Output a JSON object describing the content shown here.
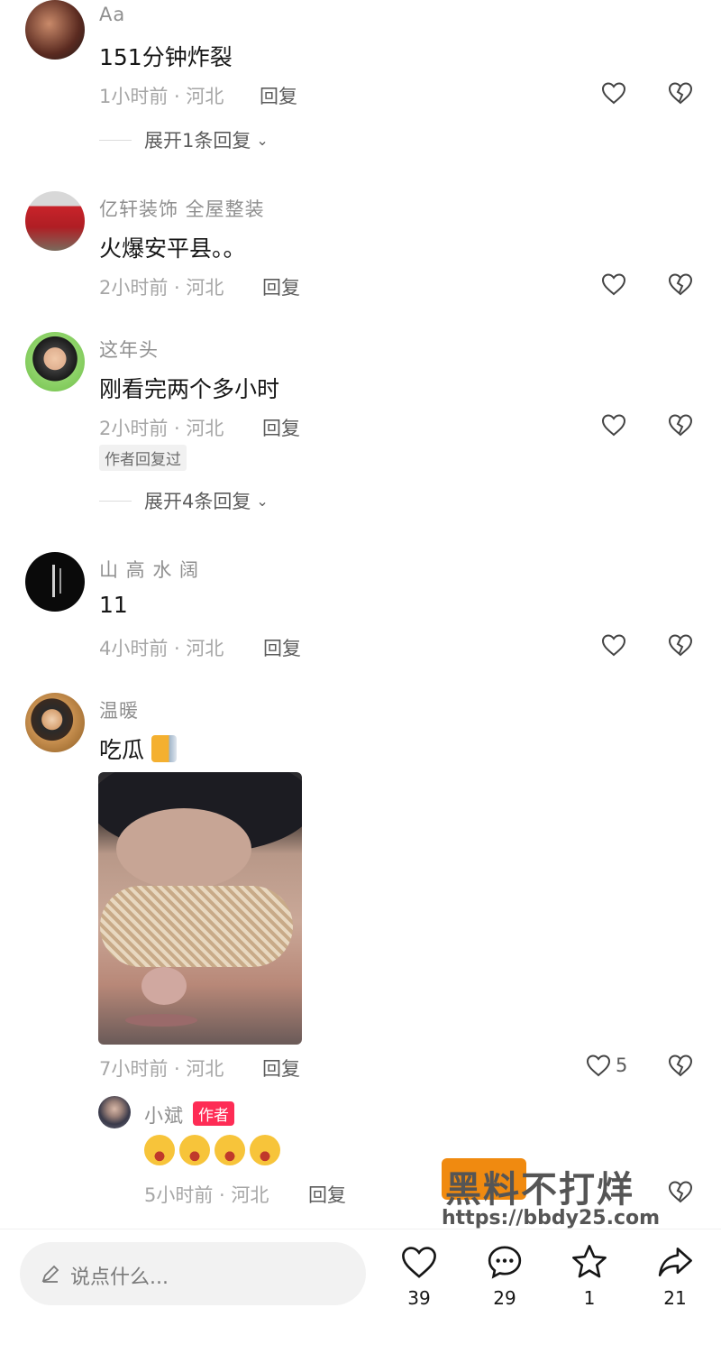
{
  "comments": [
    {
      "name": "Aa",
      "text": "151分钟炸裂",
      "meta": "1小时前 · 河北",
      "reply": "回复",
      "expand": "展开1条回复"
    },
    {
      "name": "亿轩装饰  全屋整装",
      "text": "火爆安平县。。",
      "meta": "2小时前 · 河北",
      "reply": "回复"
    },
    {
      "name": "这年头",
      "text": "刚看完两个多小时",
      "meta": "2小时前 · 河北",
      "reply": "回复",
      "badge": "作者回复过",
      "expand": "展开4条回复"
    },
    {
      "name": "山 高 水 阔",
      "text": "11",
      "meta": "4小时前 · 河北",
      "reply": "回复"
    },
    {
      "name": "温暖",
      "text": "吃瓜",
      "meta": "7小时前 · 河北",
      "reply": "回复",
      "likes": "5"
    }
  ],
  "sub_reply": {
    "name": "小斌",
    "badge": "作者",
    "meta": "5小时前 · 河北",
    "reply": "回复"
  },
  "watermark": {
    "brand": "黑料不打烊",
    "url": "https://bbdy25.com"
  },
  "bottom_bar": {
    "placeholder": "说点什么...",
    "like_count": "39",
    "comment_count": "29",
    "star_count": "1",
    "share_count": "21"
  }
}
